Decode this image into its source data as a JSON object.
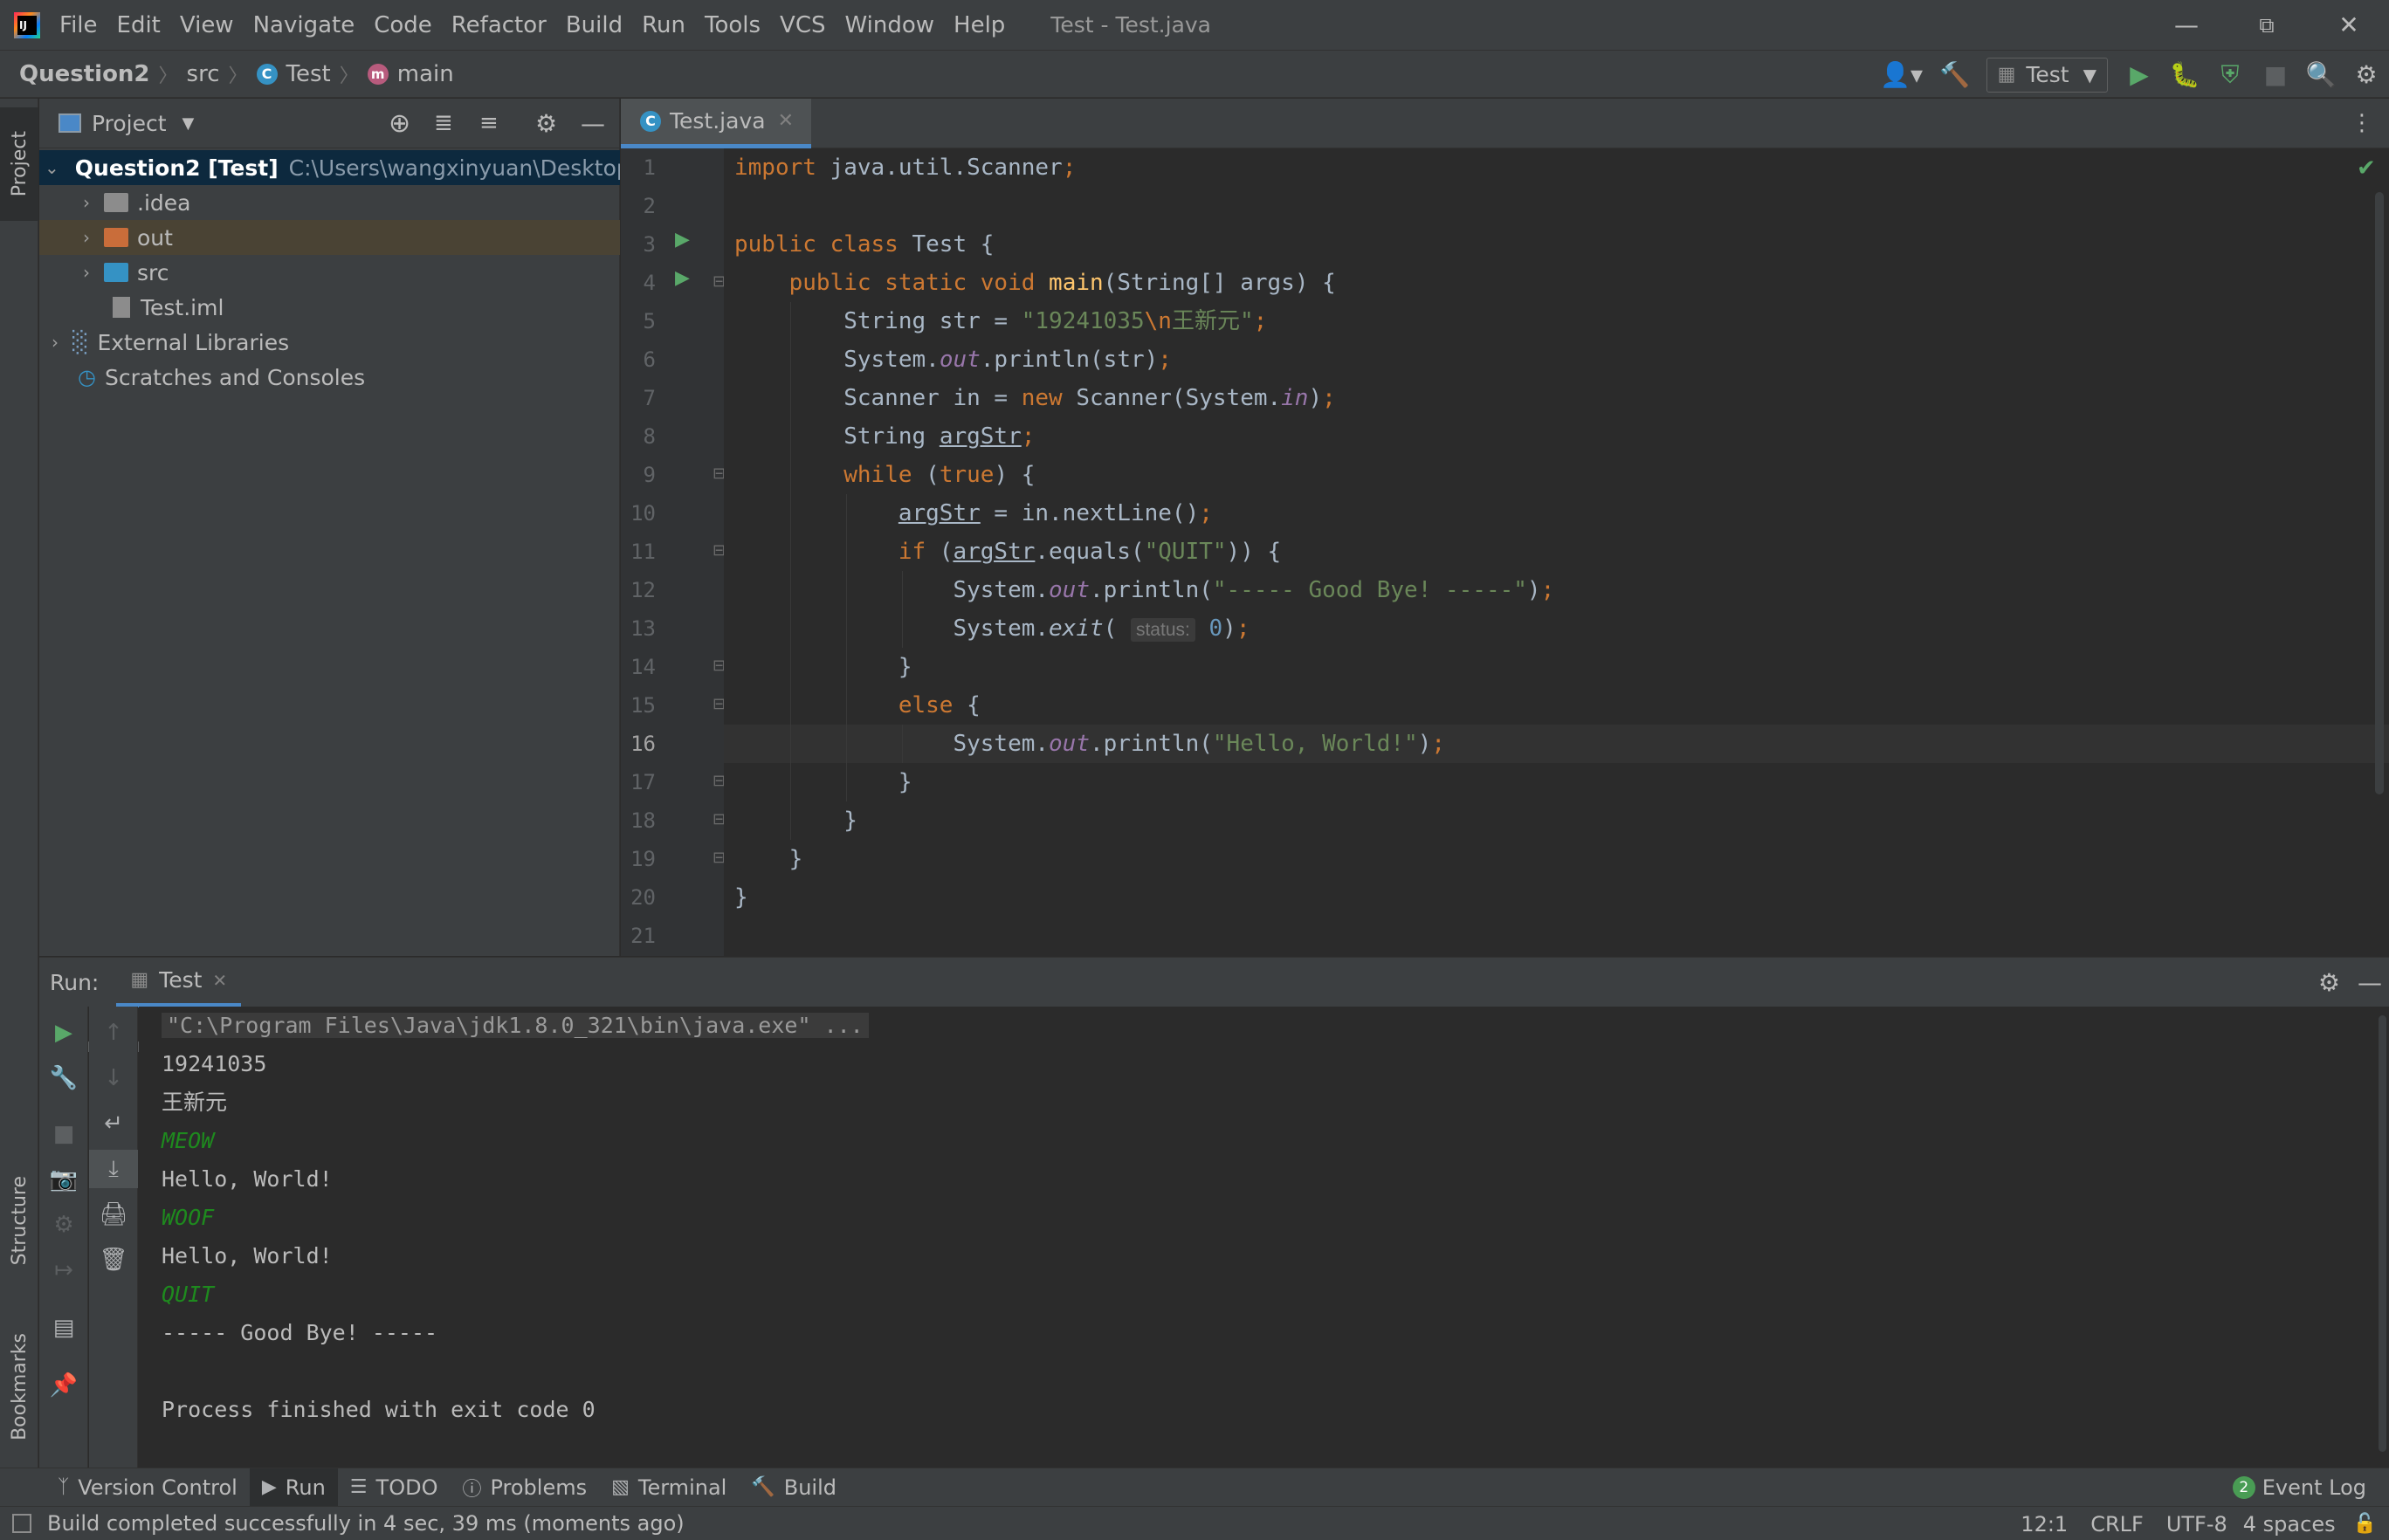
{
  "menu": {
    "items": [
      "File",
      "Edit",
      "View",
      "Navigate",
      "Code",
      "Refactor",
      "Build",
      "Run",
      "Tools",
      "VCS",
      "Window",
      "Help"
    ],
    "window_title": "Test - Test.java"
  },
  "breadcrumb": {
    "project": "Question2",
    "folder": "src",
    "class": "Test",
    "method": "main"
  },
  "toolbar": {
    "run_config": "Test"
  },
  "left_stripe": {
    "project": "Project",
    "structure": "Structure",
    "bookmarks": "Bookmarks"
  },
  "project_panel": {
    "title": "Project",
    "tree": [
      {
        "label": "Question2 [Test]",
        "path": "C:\\Users\\wangxinyuan\\Desktop\\"
      },
      {
        "label": ".idea"
      },
      {
        "label": "out"
      },
      {
        "label": "src"
      },
      {
        "label": "Test.iml"
      },
      {
        "label": "External Libraries"
      },
      {
        "label": "Scratches and Consoles"
      }
    ]
  },
  "editor": {
    "tab": "Test.java",
    "line_numbers": [
      "1",
      "2",
      "3",
      "4",
      "5",
      "6",
      "7",
      "8",
      "9",
      "10",
      "11",
      "12",
      "13",
      "14",
      "15",
      "16",
      "17",
      "18",
      "19",
      "20",
      "21"
    ],
    "current_line": "16"
  },
  "run_panel": {
    "label": "Run:",
    "tab": "Test",
    "console": [
      "\"C:\\Program Files\\Java\\jdk1.8.0_321\\bin\\java.exe\" ...",
      "19241035",
      "王新元",
      "MEOW",
      "Hello, World!",
      "WOOF",
      "Hello, World!",
      "QUIT",
      "----- Good Bye! -----",
      "",
      "Process finished with exit code 0"
    ]
  },
  "bottom_tools": [
    "Version Control",
    "Run",
    "TODO",
    "Problems",
    "Terminal",
    "Build"
  ],
  "event_log": {
    "label": "Event Log",
    "count": "2"
  },
  "status": {
    "message": "Build completed successfully in 4 sec, 39 ms (moments ago)",
    "position": "12:1",
    "line_sep": "CRLF",
    "encoding": "UTF-8",
    "indent": "4 spaces"
  },
  "colors": {
    "keyword": "#cc7832",
    "string": "#6a8759",
    "function": "#ffc66d",
    "static_field": "#9876aa",
    "number": "#6897bb",
    "console_input": "#1e8a1e",
    "run_green": "#59a869"
  }
}
